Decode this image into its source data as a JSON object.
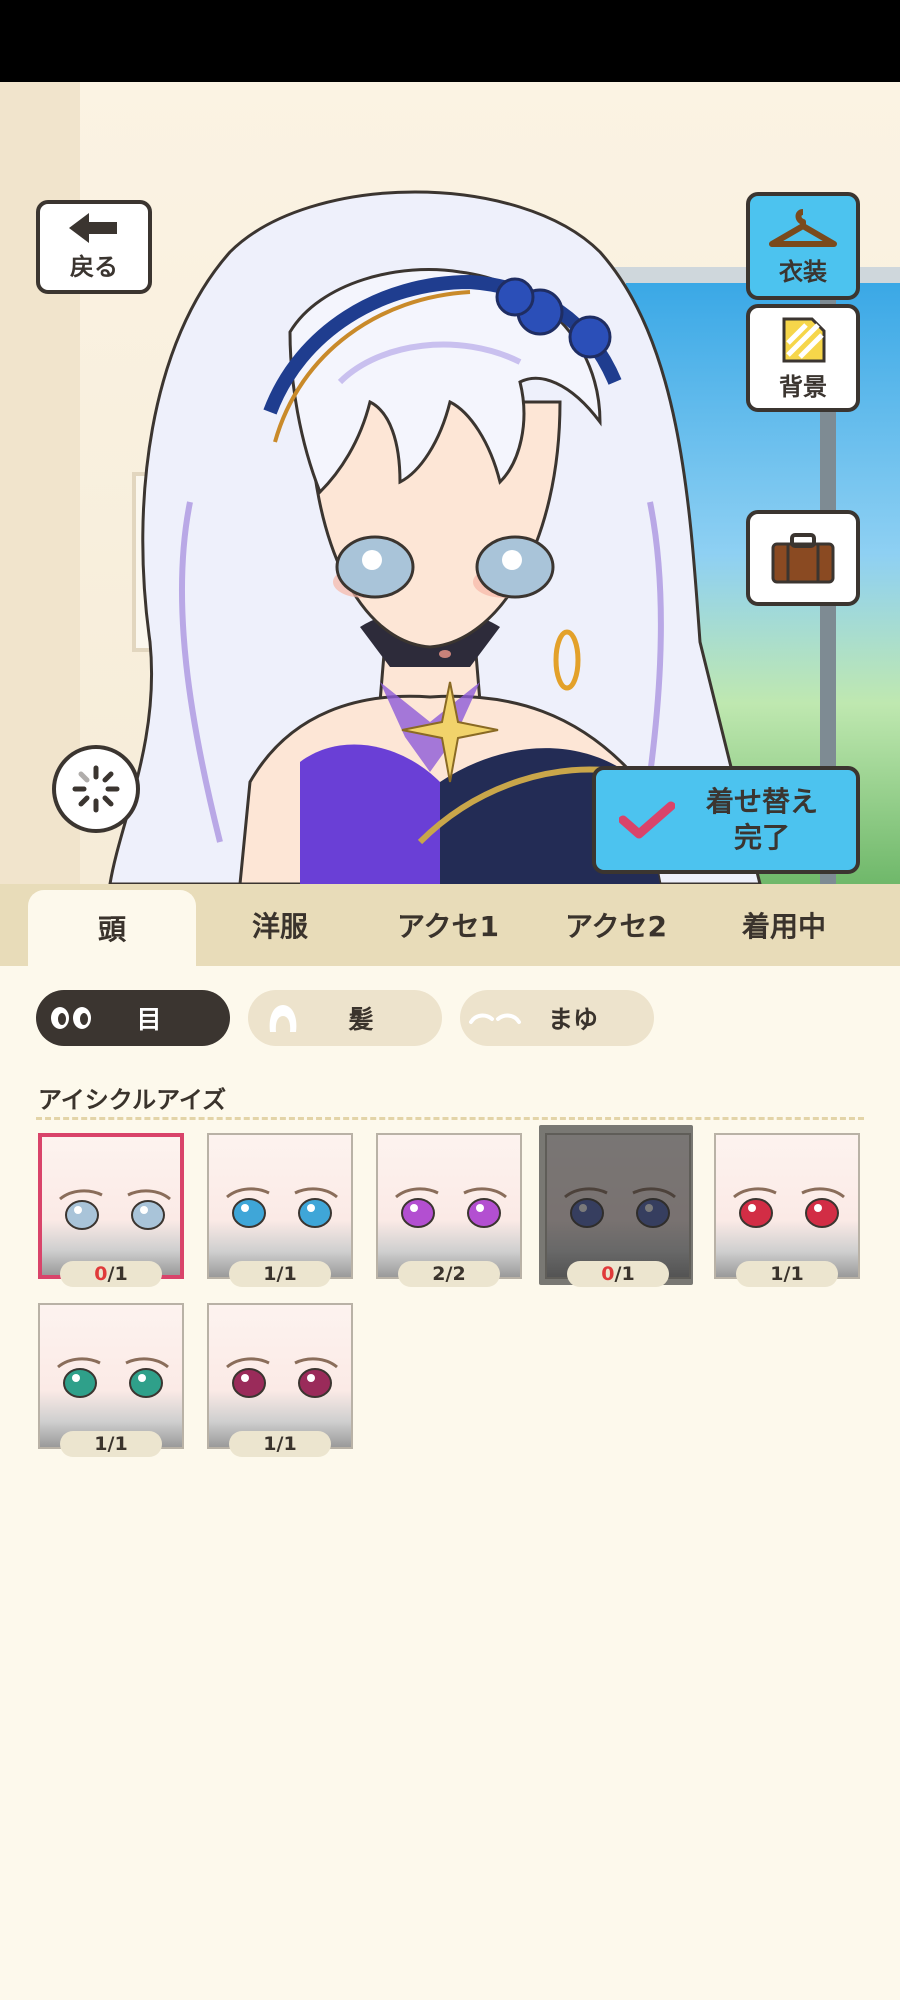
{
  "header": {
    "back_label": "戻る",
    "costume_label": "衣装",
    "background_label": "背景",
    "done_label_line1": "着せ替え",
    "done_label_line2": "完了"
  },
  "icons": {
    "back": "arrow-left-icon",
    "costume": "hanger-icon",
    "background": "document-icon",
    "bag": "suitcase-icon",
    "rotate": "loading-spinner-icon",
    "zoom": "magnifier-icon",
    "swap": "up-down-arrows-icon",
    "done": "checkmark-icon"
  },
  "colors": {
    "accent": "#4cc3ef",
    "selected_border": "#d9446a",
    "count_zero": "#e03a3a",
    "tab_bar": "#e8dcb9",
    "page_bg": "#fdf9ec"
  },
  "tabs": [
    {
      "label": "頭",
      "active": true
    },
    {
      "label": "洋服",
      "active": false
    },
    {
      "label": "アクセ1",
      "active": false
    },
    {
      "label": "アクセ2",
      "active": false
    },
    {
      "label": "着用中",
      "active": false
    }
  ],
  "subtabs": [
    {
      "label": "目",
      "icon": "eyes-icon",
      "active": true
    },
    {
      "label": "髪",
      "icon": "hair-icon",
      "active": false
    },
    {
      "label": "まゆ",
      "icon": "eyebrows-icon",
      "active": false
    }
  ],
  "section": {
    "title": "アイシクルアイズ"
  },
  "items": [
    {
      "owned": "0",
      "total": "1",
      "count_sep": "/",
      "iris": "#a9c4d9",
      "selected": true,
      "dim": false
    },
    {
      "owned": "1",
      "total": "1",
      "count_sep": "/",
      "iris": "#3fa6d8",
      "selected": false,
      "dim": false
    },
    {
      "owned": "2",
      "total": "2",
      "count_sep": "/",
      "iris": "#b34fd1",
      "selected": false,
      "dim": false
    },
    {
      "owned": "0",
      "total": "1",
      "count_sep": "/",
      "iris": "#4e63b8",
      "selected": false,
      "dim": true
    },
    {
      "owned": "1",
      "total": "1",
      "count_sep": "/",
      "iris": "#d22d45",
      "selected": false,
      "dim": false
    },
    {
      "owned": "1",
      "total": "1",
      "count_sep": "/",
      "iris": "#2fa08a",
      "selected": false,
      "dim": false
    },
    {
      "owned": "1",
      "total": "1",
      "count_sep": "/",
      "iris": "#9a2b5a",
      "selected": false,
      "dim": false
    }
  ]
}
